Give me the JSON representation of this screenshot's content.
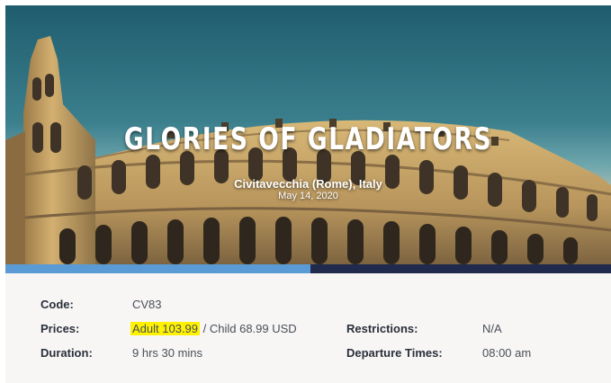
{
  "hero": {
    "title": "GLORIES OF GLADIATORS",
    "location": "Civitavecchia (Rome), Italy",
    "date": "May 14, 2020"
  },
  "details": {
    "code_label": "Code:",
    "code_value": "CV83",
    "prices_label": "Prices:",
    "prices_adult": "Adult 103.99",
    "prices_rest": " / Child 68.99 USD",
    "duration_label": "Duration:",
    "duration_value": "9 hrs 30 mins",
    "restrictions_label": "Restrictions:",
    "restrictions_value": "N/A",
    "departure_label": "Departure Times:",
    "departure_value": "08:00 am"
  },
  "colors": {
    "stripe_light": "#5b9bd5",
    "stripe_dark": "#1f2a4d",
    "highlight": "#fff200"
  }
}
